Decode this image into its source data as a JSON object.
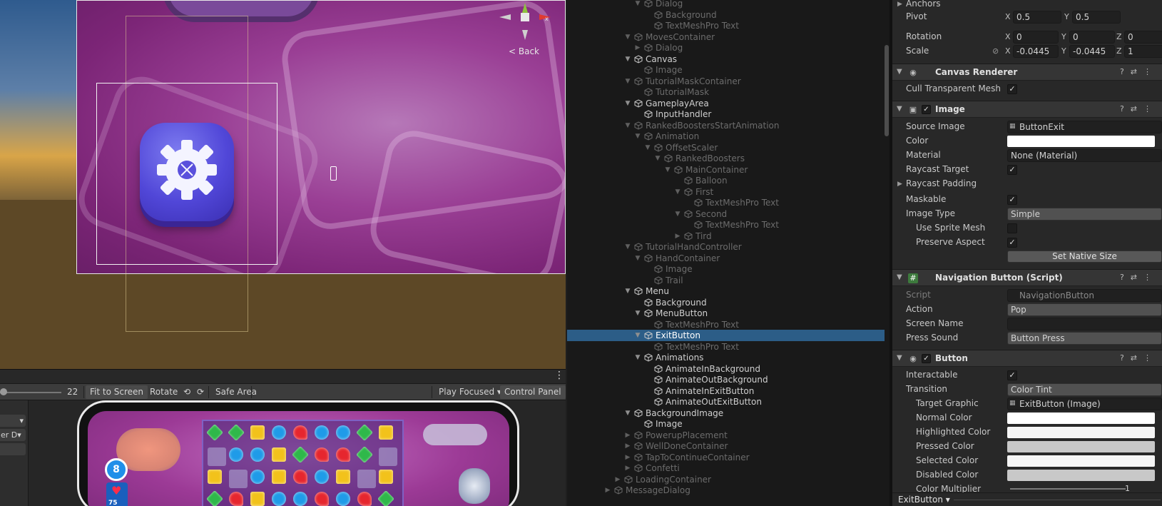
{
  "scene": {
    "back_label": "< Back",
    "gizmo_axis": "x"
  },
  "game_toolbar": {
    "scale_value": "22",
    "fit_to_screen": "Fit to Screen",
    "rotate": "Rotate",
    "safe_area": "Safe Area",
    "play_focused": "Play Focused ▾",
    "control_panel": "Control Panel"
  },
  "left_controls": {
    "dropdown_1": "▾",
    "dropdown_2": "er D▾"
  },
  "game_hud": {
    "moves": "8",
    "lives": "75"
  },
  "hierarchy": {
    "items": [
      {
        "label": "Dialog",
        "indent": 4,
        "arrow": "down",
        "state": "dim"
      },
      {
        "label": "Background",
        "indent": 5,
        "arrow": "",
        "state": "dim"
      },
      {
        "label": "TextMeshPro Text",
        "indent": 5,
        "arrow": "",
        "state": "dim"
      },
      {
        "label": "MovesContainer",
        "indent": 3,
        "arrow": "down",
        "state": "dim"
      },
      {
        "label": "Dialog",
        "indent": 4,
        "arrow": "right",
        "state": "dim"
      },
      {
        "label": "Canvas",
        "indent": 3,
        "arrow": "down",
        "state": "lit"
      },
      {
        "label": "Image",
        "indent": 4,
        "arrow": "",
        "state": "dim"
      },
      {
        "label": "TutorialMaskContainer",
        "indent": 3,
        "arrow": "down",
        "state": "dim"
      },
      {
        "label": "TutorialMask",
        "indent": 4,
        "arrow": "",
        "state": "dim"
      },
      {
        "label": "GameplayArea",
        "indent": 3,
        "arrow": "down",
        "state": "lit"
      },
      {
        "label": "InputHandler",
        "indent": 4,
        "arrow": "",
        "state": "lit"
      },
      {
        "label": "RankedBoostersStartAnimation",
        "indent": 3,
        "arrow": "down",
        "state": "dim"
      },
      {
        "label": "Animation",
        "indent": 4,
        "arrow": "down",
        "state": "dim"
      },
      {
        "label": "OffsetScaler",
        "indent": 5,
        "arrow": "down",
        "state": "dim"
      },
      {
        "label": "RankedBoosters",
        "indent": 6,
        "arrow": "down",
        "state": "dim"
      },
      {
        "label": "MainContainer",
        "indent": 7,
        "arrow": "down",
        "state": "dim"
      },
      {
        "label": "Balloon",
        "indent": 8,
        "arrow": "",
        "state": "dim"
      },
      {
        "label": "First",
        "indent": 8,
        "arrow": "down",
        "state": "dim"
      },
      {
        "label": "TextMeshPro Text",
        "indent": 9,
        "arrow": "",
        "state": "dim"
      },
      {
        "label": "Second",
        "indent": 8,
        "arrow": "down",
        "state": "dim"
      },
      {
        "label": "TextMeshPro Text",
        "indent": 9,
        "arrow": "",
        "state": "dim"
      },
      {
        "label": "Tird",
        "indent": 8,
        "arrow": "right",
        "state": "dim"
      },
      {
        "label": "TutorialHandController",
        "indent": 3,
        "arrow": "down",
        "state": "dim"
      },
      {
        "label": "HandContainer",
        "indent": 4,
        "arrow": "down",
        "state": "dim"
      },
      {
        "label": "Image",
        "indent": 5,
        "arrow": "",
        "state": "dim"
      },
      {
        "label": "Trail",
        "indent": 5,
        "arrow": "",
        "state": "dim"
      },
      {
        "label": "Menu",
        "indent": 3,
        "arrow": "down",
        "state": "lit"
      },
      {
        "label": "Background",
        "indent": 4,
        "arrow": "",
        "state": "lit"
      },
      {
        "label": "MenuButton",
        "indent": 4,
        "arrow": "down",
        "state": "lit"
      },
      {
        "label": "TextMeshPro Text",
        "indent": 5,
        "arrow": "",
        "state": "dim"
      },
      {
        "label": "ExitButton",
        "indent": 4,
        "arrow": "down",
        "state": "sel"
      },
      {
        "label": "TextMeshPro Text",
        "indent": 5,
        "arrow": "",
        "state": "dim"
      },
      {
        "label": "Animations",
        "indent": 4,
        "arrow": "down",
        "state": "lit"
      },
      {
        "label": "AnimateInBackground",
        "indent": 5,
        "arrow": "",
        "state": "lit"
      },
      {
        "label": "AnimateOutBackground",
        "indent": 5,
        "arrow": "",
        "state": "lit"
      },
      {
        "label": "AnimateInExitButton",
        "indent": 5,
        "arrow": "",
        "state": "lit"
      },
      {
        "label": "AnimateOutExitButton",
        "indent": 5,
        "arrow": "",
        "state": "lit"
      },
      {
        "label": "BackgroundImage",
        "indent": 3,
        "arrow": "down",
        "state": "lit"
      },
      {
        "label": "Image",
        "indent": 4,
        "arrow": "",
        "state": "lit"
      },
      {
        "label": "PowerupPlacement",
        "indent": 3,
        "arrow": "right",
        "state": "dim"
      },
      {
        "label": "WellDoneContainer",
        "indent": 3,
        "arrow": "right",
        "state": "dim"
      },
      {
        "label": "TapToContinueContainer",
        "indent": 3,
        "arrow": "right",
        "state": "dim"
      },
      {
        "label": "Confetti",
        "indent": 3,
        "arrow": "right",
        "state": "dim"
      },
      {
        "label": "LoadingContainer",
        "indent": 2,
        "arrow": "right",
        "state": "dim"
      },
      {
        "label": "MessageDialog",
        "indent": 1,
        "arrow": "right",
        "state": "dim"
      }
    ]
  },
  "inspector": {
    "anchors": "Anchors",
    "pivot": {
      "label": "Pivot",
      "x": "0.5",
      "y": "0.5"
    },
    "rotation": {
      "label": "Rotation",
      "x": "0",
      "y": "0",
      "z": "0"
    },
    "scale": {
      "label": "Scale",
      "x": "-0.0445",
      "y": "-0.0445",
      "z": "1"
    },
    "axis_x": "X",
    "axis_y": "Y",
    "axis_z": "Z",
    "canvas_renderer": {
      "title": "Canvas Renderer",
      "cull_label": "Cull Transparent Mesh",
      "cull": true
    },
    "image": {
      "title": "Image",
      "source_image_label": "Source Image",
      "source_image": "ButtonExit",
      "color_label": "Color",
      "color": "#ffffff",
      "material_label": "Material",
      "material": "None (Material)",
      "raycast_target_label": "Raycast Target",
      "raycast_padding_label": "Raycast Padding",
      "maskable_label": "Maskable",
      "image_type_label": "Image Type",
      "image_type": "Simple",
      "use_sprite_mesh_label": "Use Sprite Mesh",
      "preserve_aspect_label": "Preserve Aspect",
      "set_native_size": "Set Native Size"
    },
    "navigation_button": {
      "title": "Navigation Button (Script)",
      "script_label": "Script",
      "script": "NavigationButton",
      "action_label": "Action",
      "action": "Pop",
      "screen_name_label": "Screen Name",
      "screen_name": "",
      "press_sound_label": "Press Sound",
      "press_sound": "Button Press"
    },
    "button": {
      "title": "Button",
      "interactable_label": "Interactable",
      "transition_label": "Transition",
      "transition": "Color Tint",
      "target_graphic_label": "Target Graphic",
      "target_graphic": "ExitButton (Image)",
      "normal_color_label": "Normal Color",
      "normal_color": "#ffffff",
      "highlighted_color_label": "Highlighted Color",
      "highlighted_color": "#f5f5f5",
      "pressed_color_label": "Pressed Color",
      "pressed_color": "#c8c8c8",
      "selected_color_label": "Selected Color",
      "selected_color": "#f5f5f5",
      "disabled_color_label": "Disabled Color",
      "disabled_color": "#c8c8c8",
      "color_multiplier_label": "Color Multiplier",
      "color_multiplier": "1"
    },
    "footer_object": "ExitButton ▾"
  },
  "colors": {
    "selection": "#2c5d87",
    "panel_bg": "#282828",
    "hierarchy_bg": "#191919"
  }
}
